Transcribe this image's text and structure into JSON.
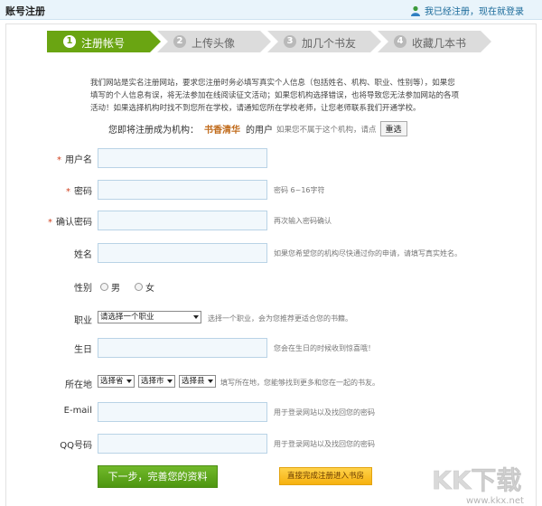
{
  "topbar": {
    "title": "账号注册",
    "login_text": "我已经注册，现在就登录"
  },
  "steps": [
    {
      "num": "1",
      "label": "注册帐号",
      "active": true
    },
    {
      "num": "2",
      "label": "上传头像",
      "active": false
    },
    {
      "num": "3",
      "label": "加几个书友",
      "active": false
    },
    {
      "num": "4",
      "label": "收藏几本书",
      "active": false
    }
  ],
  "notice": "我们网站是实名注册网站，要求您注册时务必填写真实个人信息（包括姓名、机构、职业、性别等），如果您填写的个人信息有误，将无法参加在线阅读征文活动；如果您机构选择错误，也将导致您无法参加网站的各项活动！如果选择机构时找不到您所在学校，请通知您所在学校老师，让您老师联系我们开通学校。",
  "org_line": {
    "prefix": "您即将注册成为机构：",
    "org_name": "书香清华",
    "suffix": "的用户",
    "hint": "如果您不属于这个机构，请点",
    "reselect_label": "重选"
  },
  "fields": {
    "username": {
      "label": "用户名",
      "required": "*",
      "tip": ""
    },
    "password": {
      "label": "密码",
      "required": "*",
      "tip": "密码 6~16字符"
    },
    "confirm": {
      "label": "确认密码",
      "required": "*",
      "tip": "再次输入密码确认"
    },
    "name": {
      "label": "姓名",
      "tip": "如果您希望您的机构尽快通过你的申请，请填写真实姓名。"
    },
    "gender": {
      "label": "性别",
      "options": [
        "男",
        "女"
      ]
    },
    "job": {
      "label": "职业",
      "selected": "请选择一个职业",
      "tip": "选择一个职业，会为您推荐更适合您的书籍。"
    },
    "birthday": {
      "label": "生日",
      "tip": "您会在生日的时候收到惊喜哦！"
    },
    "location": {
      "label": "所在地",
      "province": "选择省",
      "city": "选择市",
      "county": "选择县",
      "tip": "填写所在地，您能够找到更多和您在一起的书友。"
    },
    "email": {
      "label": "E-mail",
      "tip": "用于登录网站以及找回您的密码"
    },
    "qq": {
      "label": "QQ号码",
      "tip": "用于登录网站以及找回您的密码"
    }
  },
  "buttons": {
    "next": "下一步，完善您的资料",
    "skip": "直接完成注册进入书房"
  },
  "watermark": {
    "logo_text": "KK下载",
    "url": "www.kkx.net"
  },
  "colors": {
    "accent_green": "#6aa512",
    "step_off": "#d9d9d9",
    "required": "#d0411f",
    "org": "#c06a1a",
    "skip": "#f6b10f"
  }
}
